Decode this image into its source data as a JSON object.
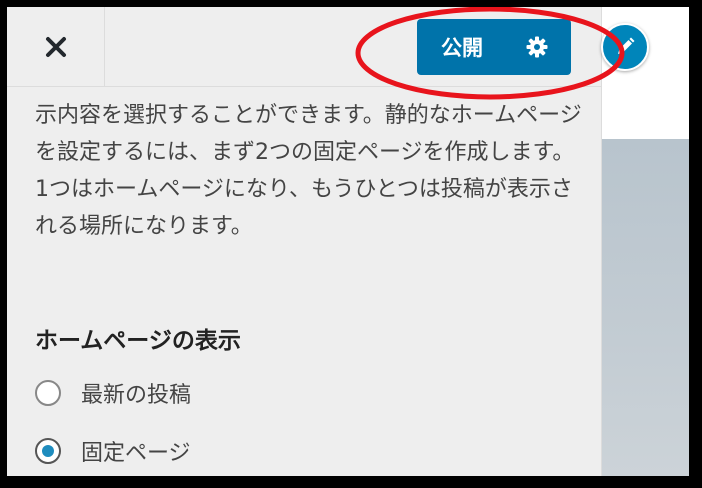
{
  "header": {
    "close_icon": "close-icon",
    "publish_label": "公開",
    "settings_icon": "gear-icon"
  },
  "panel": {
    "description": "示内容を選択することができます。静的なホームページを設定するには、まず2つの固定ページを作成します。1つはホームページになり、もうひとつは投稿が表示される場所になります。",
    "section_title": "ホームページの表示",
    "options": [
      {
        "label": "最新の投稿",
        "checked": false
      },
      {
        "label": "固定ページ",
        "checked": true
      }
    ]
  },
  "preview": {
    "edit_icon": "pencil-icon"
  },
  "colors": {
    "accent": "#0073aa",
    "radio_selected": "#1e8cbe",
    "annotation": "#e8141c"
  }
}
